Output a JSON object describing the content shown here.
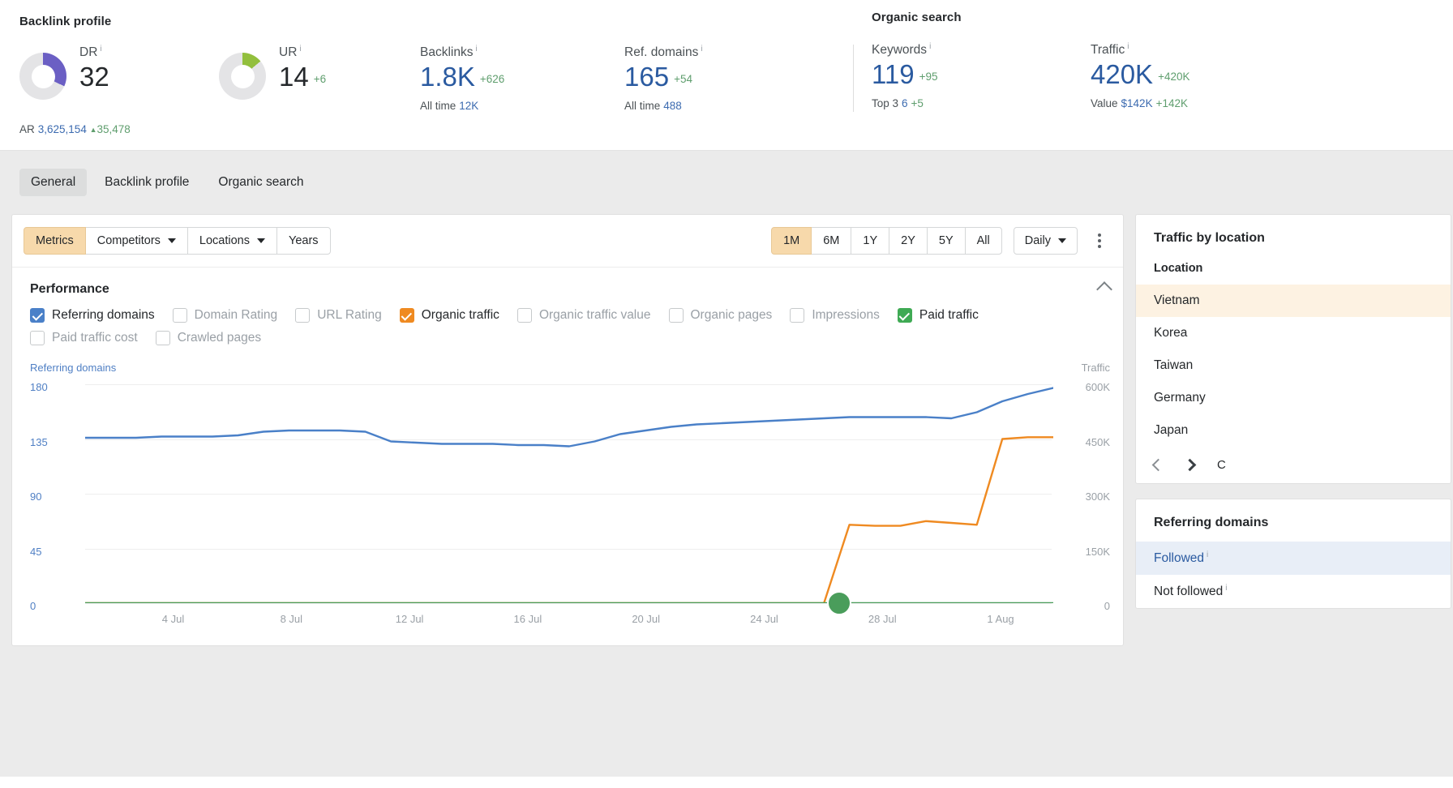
{
  "header": {
    "backlink_profile_title": "Backlink profile",
    "organic_search_title": "Organic search",
    "metrics": {
      "dr": {
        "label": "DR",
        "value": "32",
        "donut_pct": 32,
        "donut_color": "#6b5fc4",
        "sub_label": "AR",
        "sub_value": "3,625,154",
        "sub_delta": "35,478",
        "sub_arrow": "▲"
      },
      "ur": {
        "label": "UR",
        "value": "14",
        "delta": "+6",
        "donut_pct": 14,
        "donut_color": "#92bf3d"
      },
      "backlinks": {
        "label": "Backlinks",
        "value": "1.8K",
        "delta": "+626",
        "sub_label": "All time",
        "sub_value": "12K"
      },
      "ref_domains": {
        "label": "Ref. domains",
        "value": "165",
        "delta": "+54",
        "sub_label": "All time",
        "sub_value": "488"
      },
      "keywords": {
        "label": "Keywords",
        "value": "119",
        "delta": "+95",
        "sub_label": "Top 3",
        "sub_value": "6",
        "sub_delta": "+5"
      },
      "traffic": {
        "label": "Traffic",
        "value": "420K",
        "delta": "+420K",
        "sub_label": "Value",
        "sub_value": "$142K",
        "sub_delta": "+142K"
      }
    }
  },
  "tabs": [
    {
      "label": "General",
      "active": true
    },
    {
      "label": "Backlink profile",
      "active": false
    },
    {
      "label": "Organic search",
      "active": false
    }
  ],
  "toolbar": {
    "metrics_label": "Metrics",
    "competitors_label": "Competitors",
    "locations_label": "Locations",
    "years_label": "Years",
    "ranges": [
      "1M",
      "6M",
      "1Y",
      "2Y",
      "5Y",
      "All"
    ],
    "selected_range": "1M",
    "granularity_label": "Daily",
    "more_label": "more-options"
  },
  "performance": {
    "title": "Performance",
    "legend": [
      {
        "label": "Referring domains",
        "checked": true,
        "color": "#4a80c8"
      },
      {
        "label": "Domain Rating",
        "checked": false,
        "color": ""
      },
      {
        "label": "URL Rating",
        "checked": false,
        "color": ""
      },
      {
        "label": "Organic traffic",
        "checked": true,
        "color": "#ef8a21"
      },
      {
        "label": "Organic traffic value",
        "checked": false,
        "color": ""
      },
      {
        "label": "Organic pages",
        "checked": false,
        "color": ""
      },
      {
        "label": "Impressions",
        "checked": false,
        "color": ""
      },
      {
        "label": "Paid traffic",
        "checked": true,
        "color": "#3faa54"
      },
      {
        "label": "Paid traffic cost",
        "checked": false,
        "color": ""
      },
      {
        "label": "Crawled pages",
        "checked": false,
        "color": ""
      }
    ]
  },
  "chart_data": {
    "type": "line",
    "title": "Performance",
    "left_axis_name": "Referring domains",
    "right_axis_name": "Traffic",
    "left_ticks": [
      "180",
      "135",
      "90",
      "45",
      "0"
    ],
    "right_ticks": [
      "600K",
      "450K",
      "300K",
      "150K",
      "0"
    ],
    "left_ylim": [
      0,
      180
    ],
    "right_ylim": [
      0,
      600000
    ],
    "xlabel": "",
    "ylabel": "Referring domains",
    "grid": true,
    "legend_position": "top",
    "x_ticks": [
      "4 Jul",
      "8 Jul",
      "12 Jul",
      "16 Jul",
      "20 Jul",
      "24 Jul",
      "28 Jul",
      "1 Aug"
    ],
    "x_tick_positions": [
      0.0909,
      0.213,
      0.3351,
      0.4572,
      0.5793,
      0.7014,
      0.8235,
      0.9456
    ],
    "hover_marker": {
      "x_frac": 0.779,
      "value": "0",
      "series": "Paid traffic",
      "color": "#4a9d5b"
    },
    "series": [
      {
        "name": "Referring domains",
        "axis": "left",
        "color": "#4a80c8",
        "values": [
          136,
          136,
          136,
          137,
          137,
          137,
          138,
          141,
          142,
          142,
          142,
          141,
          133,
          132,
          131,
          131,
          131,
          130,
          130,
          129,
          133,
          139,
          142,
          145,
          147,
          148,
          149,
          150,
          151,
          152,
          153,
          153,
          153,
          153,
          152,
          157,
          166,
          172,
          177
        ]
      },
      {
        "name": "Organic traffic",
        "axis": "right",
        "color": "#ef8a21",
        "values": [
          0,
          0,
          0,
          0,
          0,
          0,
          0,
          0,
          0,
          0,
          0,
          0,
          0,
          0,
          0,
          0,
          0,
          0,
          0,
          0,
          0,
          0,
          0,
          0,
          0,
          0,
          0,
          0,
          0,
          0,
          215000,
          212000,
          212000,
          225000,
          220000,
          215000,
          450000,
          455000,
          455000
        ]
      },
      {
        "name": "Paid traffic",
        "axis": "right",
        "color": "#4a9d5b",
        "values": [
          0,
          0,
          0,
          0,
          0,
          0,
          0,
          0,
          0,
          0,
          0,
          0,
          0,
          0,
          0,
          0,
          0,
          0,
          0,
          0,
          0,
          0,
          0,
          0,
          0,
          0,
          0,
          0,
          0,
          0,
          0,
          0,
          0,
          0,
          0,
          0,
          0,
          0,
          0
        ]
      }
    ]
  },
  "traffic_by_location": {
    "title": "Traffic by location",
    "column_header": "Location",
    "rows": [
      {
        "name": "Vietnam",
        "highlight": true
      },
      {
        "name": "Korea",
        "highlight": false
      },
      {
        "name": "Taiwan",
        "highlight": false
      },
      {
        "name": "Germany",
        "highlight": false
      },
      {
        "name": "Japan",
        "highlight": false
      }
    ],
    "pager_label": "C"
  },
  "referring_domains_panel": {
    "title": "Referring domains",
    "tabs": [
      {
        "label": "Followed",
        "selected": true
      },
      {
        "label": "Not followed",
        "selected": false
      }
    ]
  }
}
